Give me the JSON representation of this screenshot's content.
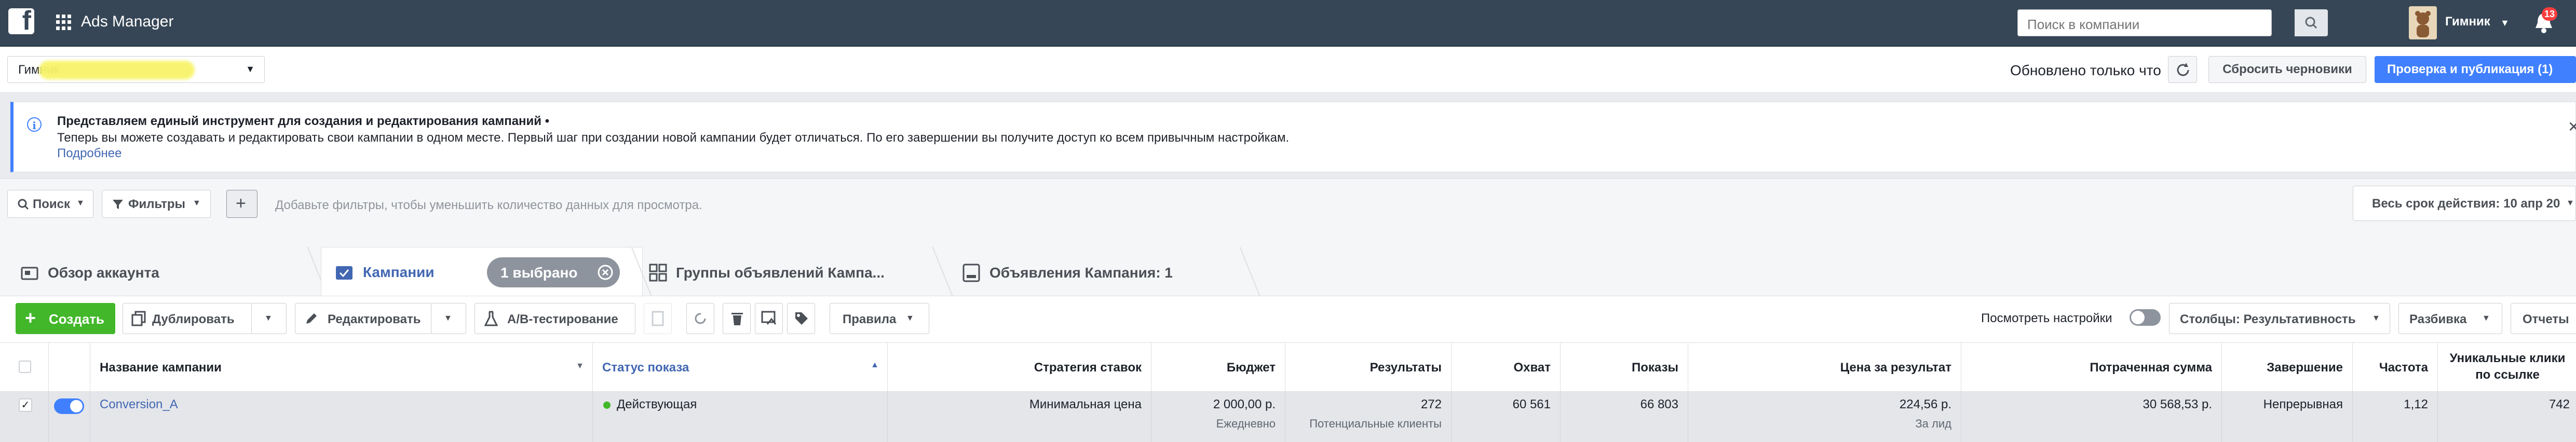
{
  "topbar": {
    "app_title": "Ads Manager",
    "search_placeholder": "Поиск в компании",
    "user_name": "Гимник",
    "notifications_count": "13"
  },
  "account": {
    "name": "Гимник"
  },
  "status": {
    "updated_text": "Обновлено только что",
    "reset_label": "Сбросить черновики",
    "publish_label": "Проверка и публикация (1)"
  },
  "banner": {
    "title": "Представляем единый инструмент для создания и редактирования кампаний •",
    "text": "Теперь вы можете создавать и редактировать свои кампании в одном месте. Первый шаг при создании новой кампании будет отличаться. По его завершении вы получите доступ ко всем привычным настройкам.",
    "link": "Подробнее"
  },
  "filters": {
    "search_label": "Поиск",
    "filters_label": "Фильтры",
    "hint": "Добавьте фильтры, чтобы уменьшить количество данных для просмотра.",
    "date_label": "Весь срок действия: 10 апр 20"
  },
  "tabs": {
    "overview": "Обзор аккаунта",
    "campaigns": "Кампании",
    "selected": "1 выбрано",
    "adsets": "Группы объявлений Кампа...",
    "ads": "Объявления Кампания: 1"
  },
  "toolbar": {
    "create": "Создать",
    "duplicate": "Дублировать",
    "edit": "Редактировать",
    "ab_test": "A/B-тестирование",
    "rules": "Правила",
    "view_settings": "Посмотреть настройки",
    "columns": "Столбцы: Результативность",
    "breakdown": "Разбивка",
    "reports": "Отчеты"
  },
  "table": {
    "headers": {
      "name": "Название кампании",
      "status": "Статус показа",
      "strategy": "Стратегия ставок",
      "budget": "Бюджет",
      "results": "Результаты",
      "reach": "Охват",
      "impressions": "Показы",
      "cost_per_result": "Цена за результат",
      "spent": "Потраченная сумма",
      "ends": "Завершение",
      "frequency": "Частота",
      "unique_clicks": "Уникальные клики по ссылке"
    },
    "row": {
      "name": "Conversion_A",
      "status": "Действующая",
      "strategy": "Минимальная цена",
      "budget": "2 000,00 р.",
      "budget_sub": "Ежедневно",
      "results": "272",
      "results_sub": "Потенциальные клиенты",
      "reach": "60 561",
      "impressions": "66 803",
      "cost_per_result": "224,56 р.",
      "cost_sub": "За лид",
      "spent": "30 568,53 р.",
      "ends": "Непрерывная",
      "frequency": "1,12",
      "unique_clicks": "742"
    }
  },
  "colors": {
    "topbar": "#364656",
    "primary": "#4080ff",
    "create": "#42b72a",
    "link": "#4267b2",
    "active_status": "#42b72a"
  }
}
